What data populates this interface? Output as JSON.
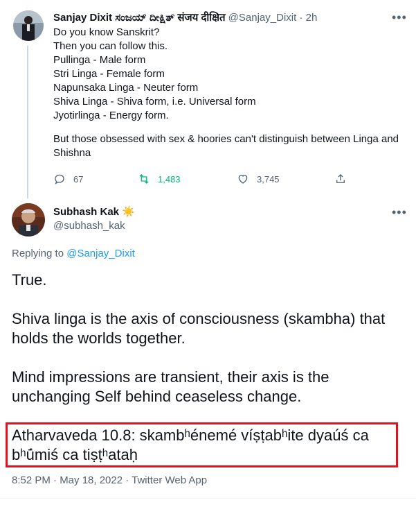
{
  "tweet1": {
    "name": "Sanjay Dixit ಸಂಜಯ್ ದೀಕ್ಷಿತ್ संजय दीक्षित",
    "handle": "@Sanjay_Dixit",
    "time": "· 2h",
    "lines": [
      "Do you know Sanskrit?",
      "Then you can follow this.",
      "Pullinga - Male form",
      "Stri Linga - Female form",
      "Napunsaka Linga - Neuter form",
      "Shiva Linga - Shiva form, i.e. Universal form",
      "Jyotirlinga - Energy form."
    ],
    "closing": "But those obsessed with sex & hoories can't distinguish between Linga and Shishna",
    "replies": "67",
    "retweets": "1,483",
    "likes": "3,745"
  },
  "tweet2": {
    "name": "Subhash Kak",
    "name_emoji": "☀️",
    "handle": "@subhash_kak",
    "replying_prefix": "Replying to",
    "replying_handle": "@Sanjay_Dixit",
    "para1": "True.",
    "para2": "Shiva linga is the axis of consciousness (skambha) that holds the worlds together.",
    "para3": "Mind impressions are transient, their axis is the unchanging Self behind ceaseless change.",
    "quote": "Atharvaveda 10.8:  skambʰénemé víṣṭabʰite dyaúś ca bʰū́miś ca tiṣṭʰataḥ",
    "timestamp": "8:52 PM · May 18, 2022 · Twitter Web App"
  },
  "colors": {
    "text": "#0f1419",
    "secondary": "#536471",
    "link": "#1d9bf0",
    "retweet": "#00ba7c",
    "highlight_border": "#e0141e"
  },
  "icons": {
    "reply": "reply-icon",
    "retweet": "retweet-icon",
    "like": "heart-icon",
    "share": "share-icon",
    "more": "more-icon"
  }
}
